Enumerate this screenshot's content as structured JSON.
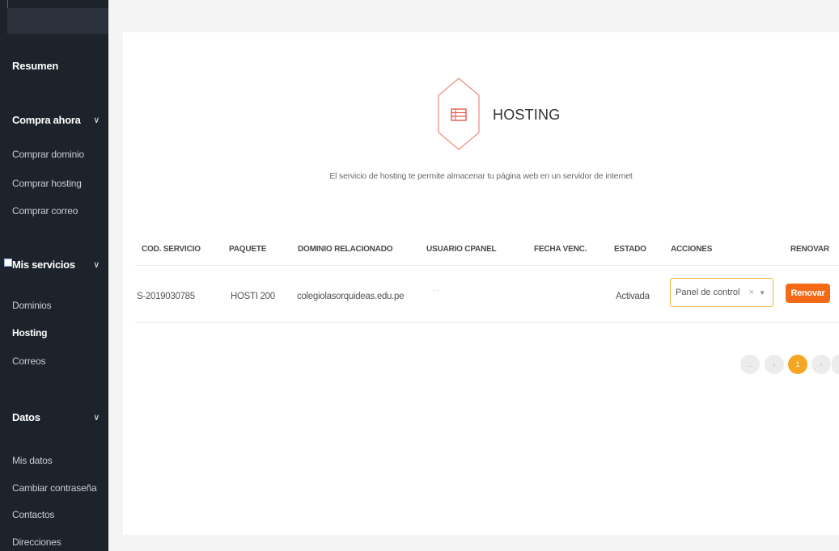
{
  "sidebar": {
    "summary": "Resumen",
    "groups": [
      {
        "label": "Compra ahora",
        "chevron": "chevron-down-icon",
        "items": [
          "Comprar dominio",
          "Comprar hosting",
          "Comprar correo"
        ]
      },
      {
        "label": "Mis servicios",
        "chevron": "chevron-down-icon",
        "items": [
          "Dominios",
          "Hosting",
          "Correos"
        ],
        "active": "Hosting"
      },
      {
        "label": "Datos",
        "chevron": "chevron-down-icon",
        "items": [
          "Mis datos",
          "Cambiar contraseña",
          "Contactos",
          "Direcciones"
        ]
      }
    ]
  },
  "header": {
    "icon": "server-icon",
    "title": "HOSTING",
    "subtitle": "El servicio de hosting te permite almacenar tu página web en un servidor de internet"
  },
  "table": {
    "columns": [
      "COD. SERVICIO",
      "PAQUETE",
      "DOMINIO RELACIONADO",
      "USUARIO CPANEL",
      "FECHA VENC.",
      "ESTADO",
      "ACCIONES",
      "RENOVAR"
    ],
    "rows": [
      {
        "code": "S-2019030785",
        "package": "HOSTI 200",
        "domain": "colegiolasorquideas.edu.pe",
        "cpanel_user": "- -",
        "expiry": "",
        "status": "Activada",
        "action_selected": "Panel de control",
        "renew_label": "Renovar"
      }
    ]
  },
  "pagination": {
    "first": "...",
    "prev": "‹",
    "current": "1",
    "next": "›",
    "last": "..."
  },
  "colors": {
    "sidebar_bg": "#1d232b",
    "accent_orange": "#f56a16",
    "page_active": "#f5a623",
    "hex_outline": "#f08a7e"
  }
}
